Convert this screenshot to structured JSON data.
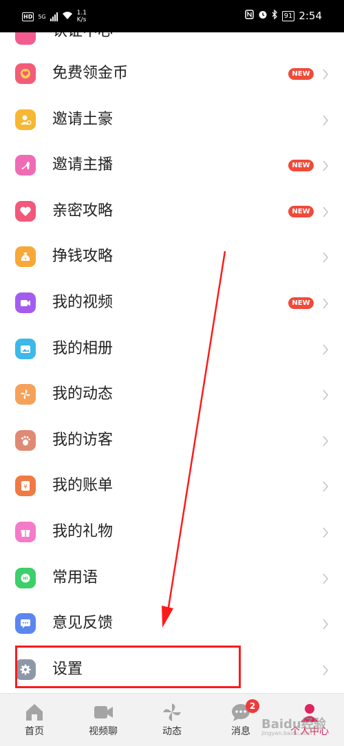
{
  "status_bar": {
    "left_badge": "HD",
    "signal": "5G",
    "speed_value": "1.1",
    "speed_unit": "K/s",
    "battery": "91",
    "time": "2:54"
  },
  "menu": {
    "partial_label": "认证中心",
    "new_badge": "NEW",
    "items": [
      {
        "label": "免费领金币",
        "icon": "coin-icon",
        "color": "#f25c78",
        "new": true
      },
      {
        "label": "邀请土豪",
        "icon": "invite-user-icon",
        "color": "#f7b733",
        "new": false
      },
      {
        "label": "邀请主播",
        "icon": "high-heel-icon",
        "color": "#f06bb5",
        "new": true
      },
      {
        "label": "亲密攻略",
        "icon": "heart-icon",
        "color": "#f2587a",
        "new": true
      },
      {
        "label": "挣钱攻略",
        "icon": "money-bag-icon",
        "color": "#f7a838",
        "new": false
      },
      {
        "label": "我的视频",
        "icon": "video-camera-icon",
        "color": "#a35cf0",
        "new": true
      },
      {
        "label": "我的相册",
        "icon": "photo-album-icon",
        "color": "#3db8e8",
        "new": false
      },
      {
        "label": "我的动态",
        "icon": "pinwheel-icon",
        "color": "#f6a15a",
        "new": false
      },
      {
        "label": "我的访客",
        "icon": "footprint-icon",
        "color": "#e08a74",
        "new": false
      },
      {
        "label": "我的账单",
        "icon": "bill-icon",
        "color": "#f07a44",
        "new": false
      },
      {
        "label": "我的礼物",
        "icon": "gift-icon",
        "color": "#f57ac9",
        "new": false
      },
      {
        "label": "常用语",
        "icon": "quick-reply-icon",
        "color": "#3ccf6a",
        "new": false
      },
      {
        "label": "意见反馈",
        "icon": "feedback-icon",
        "color": "#5b86f0",
        "new": false
      },
      {
        "label": "设置",
        "icon": "settings-gear-icon",
        "color": "#8c97a8",
        "new": false
      }
    ]
  },
  "tabs": [
    {
      "label": "首页",
      "icon": "home-icon"
    },
    {
      "label": "视频聊",
      "icon": "video-chat-icon"
    },
    {
      "label": "动态",
      "icon": "pinwheel-icon"
    },
    {
      "label": "消息",
      "icon": "message-icon",
      "badge": "2"
    },
    {
      "label": "个人中心",
      "icon": "profile-icon",
      "active": true
    }
  ],
  "watermark": {
    "text": "Baidu经验",
    "sub": "jingyan.baidu.com"
  }
}
